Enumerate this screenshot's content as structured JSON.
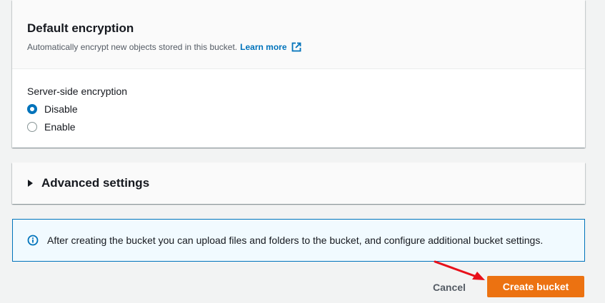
{
  "encryption": {
    "title": "Default encryption",
    "description": "Automatically encrypt new objects stored in this bucket.",
    "learn_more": "Learn more",
    "field_label": "Server-side encryption",
    "options": [
      {
        "label": "Disable",
        "selected": true
      },
      {
        "label": "Enable",
        "selected": false
      }
    ]
  },
  "advanced": {
    "title": "Advanced settings"
  },
  "info": {
    "text": "After creating the bucket you can upload files and folders to the bucket, and configure additional bucket settings."
  },
  "actions": {
    "cancel_label": "Cancel",
    "create_label": "Create bucket"
  },
  "colors": {
    "accent": "#0073bb",
    "primary_button": "#ec7211",
    "annotation_arrow": "#e8101a"
  },
  "icons": {
    "external_link": "external-link-icon",
    "info": "info-icon",
    "caret": "caret-right-icon",
    "annotation": "red-arrow-annotation"
  }
}
